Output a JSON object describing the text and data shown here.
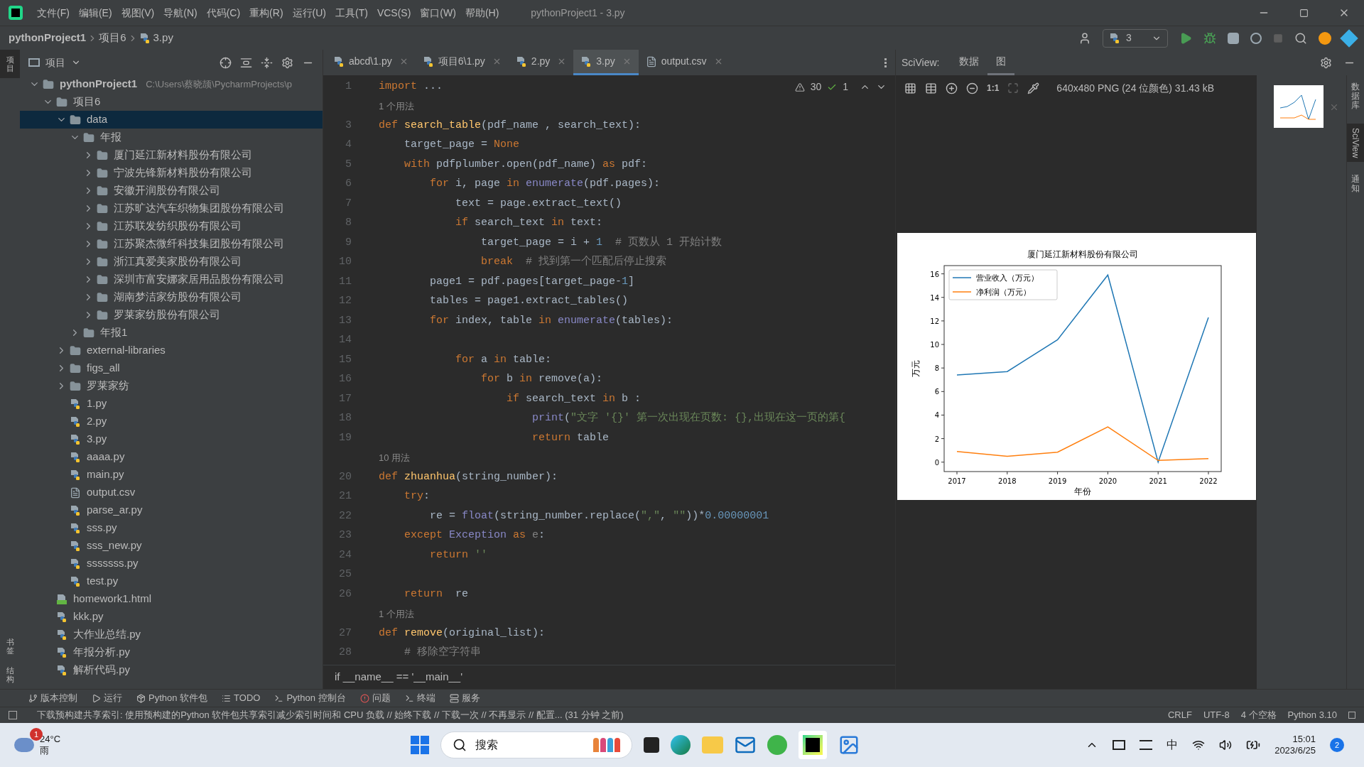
{
  "menu": [
    "文件(F)",
    "编辑(E)",
    "视图(V)",
    "导航(N)",
    "代码(C)",
    "重构(R)",
    "运行(U)",
    "工具(T)",
    "VCS(S)",
    "窗口(W)",
    "帮助(H)"
  ],
  "window": {
    "title": "pythonProject1 - 3.py"
  },
  "breadcrumb": [
    "pythonProject1",
    "项目6",
    "3.py"
  ],
  "run_config": "3",
  "left_strip": [
    {
      "label": "项目",
      "selected": true
    },
    {
      "label": "书签",
      "selected": false
    },
    {
      "label": "结构",
      "selected": false
    }
  ],
  "project_panel": {
    "title": "项目",
    "tree": [
      {
        "label": "pythonProject1",
        "path": "C:\\Users\\蔡晓颉\\PycharmProjects\\p",
        "kind": "folder",
        "expanded": true,
        "selected": false,
        "children": [
          {
            "label": "项目6",
            "kind": "folder",
            "expanded": true,
            "selected": false,
            "children": [
              {
                "label": "data",
                "kind": "folder",
                "expanded": true,
                "selected": true,
                "children": [
                  {
                    "label": "年报",
                    "kind": "folder",
                    "expanded": true,
                    "selected": false,
                    "children": [
                      {
                        "label": "厦门延江新材料股份有限公司",
                        "kind": "folder",
                        "expanded": false,
                        "selected": false
                      },
                      {
                        "label": "宁波先锋新材料股份有限公司",
                        "kind": "folder",
                        "expanded": false,
                        "selected": false
                      },
                      {
                        "label": "安徽开润股份有限公司",
                        "kind": "folder",
                        "expanded": false,
                        "selected": false
                      },
                      {
                        "label": "江苏旷达汽车织物集团股份有限公司",
                        "kind": "folder",
                        "expanded": false,
                        "selected": false
                      },
                      {
                        "label": "江苏联发纺织股份有限公司",
                        "kind": "folder",
                        "expanded": false,
                        "selected": false
                      },
                      {
                        "label": "江苏聚杰微纤科技集团股份有限公司",
                        "kind": "folder",
                        "expanded": false,
                        "selected": false
                      },
                      {
                        "label": "浙江真爱美家股份有限公司",
                        "kind": "folder",
                        "expanded": false,
                        "selected": false
                      },
                      {
                        "label": "深圳市富安娜家居用品股份有限公司",
                        "kind": "folder",
                        "expanded": false,
                        "selected": false
                      },
                      {
                        "label": "湖南梦洁家纺股份有限公司",
                        "kind": "folder",
                        "expanded": false,
                        "selected": false
                      },
                      {
                        "label": "罗莱家纺股份有限公司",
                        "kind": "folder",
                        "expanded": false,
                        "selected": false
                      }
                    ]
                  },
                  {
                    "label": "年报1",
                    "kind": "folder",
                    "expanded": false,
                    "selected": false
                  }
                ]
              },
              {
                "label": "external-libraries",
                "kind": "folder",
                "expanded": false,
                "selected": false
              },
              {
                "label": "figs_all",
                "kind": "folder",
                "expanded": false,
                "selected": false
              },
              {
                "label": "罗莱家纺",
                "kind": "folder",
                "expanded": false,
                "selected": false
              },
              {
                "label": "1.py",
                "kind": "py",
                "selected": false
              },
              {
                "label": "2.py",
                "kind": "py",
                "selected": false
              },
              {
                "label": "3.py",
                "kind": "py",
                "selected": false
              },
              {
                "label": "aaaa.py",
                "kind": "py",
                "selected": false
              },
              {
                "label": "main.py",
                "kind": "py",
                "selected": false
              },
              {
                "label": "output.csv",
                "kind": "csv",
                "selected": false
              },
              {
                "label": "parse_ar.py",
                "kind": "py",
                "selected": false
              },
              {
                "label": "sss.py",
                "kind": "py",
                "selected": false
              },
              {
                "label": "sss_new.py",
                "kind": "py",
                "selected": false
              },
              {
                "label": "sssssss.py",
                "kind": "py",
                "selected": false
              },
              {
                "label": "test.py",
                "kind": "py",
                "selected": false
              }
            ]
          },
          {
            "label": "homework1.html",
            "kind": "html",
            "selected": false
          },
          {
            "label": "kkk.py",
            "kind": "py",
            "selected": false
          },
          {
            "label": "大作业总结.py",
            "kind": "py",
            "selected": false
          },
          {
            "label": "年报分析.py",
            "kind": "py",
            "selected": false
          },
          {
            "label": "解析代码.py",
            "kind": "py",
            "selected": false
          }
        ]
      }
    ]
  },
  "editor_tabs": [
    {
      "label": "abcd\\1.py",
      "kind": "py",
      "selected": false
    },
    {
      "label": "项目6\\1.py",
      "kind": "py",
      "selected": false
    },
    {
      "label": "2.py",
      "kind": "py",
      "selected": false
    },
    {
      "label": "3.py",
      "kind": "py",
      "selected": true
    },
    {
      "label": "output.csv",
      "kind": "csv",
      "selected": false
    }
  ],
  "inspections": {
    "warnings": "30",
    "ok": "1"
  },
  "code": [
    {
      "kind": "code",
      "number": "1",
      "tokens": [
        {
          "kind": "kw",
          "s": "import"
        },
        {
          "kind": "plain",
          "s": " ..."
        }
      ]
    },
    {
      "kind": "hint",
      "text": "1 个用法"
    },
    {
      "kind": "code",
      "number": "3",
      "tokens": [
        {
          "kind": "kw",
          "s": "def "
        },
        {
          "kind": "fn",
          "s": "search_table"
        },
        {
          "kind": "plain",
          "s": "(pdf_name , search_text):"
        }
      ]
    },
    {
      "kind": "code",
      "number": "4",
      "tokens": [
        {
          "kind": "plain",
          "s": "    target_page = "
        },
        {
          "kind": "kw",
          "s": "None"
        }
      ]
    },
    {
      "kind": "code",
      "number": "5",
      "tokens": [
        {
          "kind": "kw",
          "s": "    with"
        },
        {
          "kind": "plain",
          "s": " pdfplumber.open(pdf_name) "
        },
        {
          "kind": "kw",
          "s": "as"
        },
        {
          "kind": "plain",
          "s": " pdf:"
        }
      ]
    },
    {
      "kind": "code",
      "number": "6",
      "tokens": [
        {
          "kind": "kw",
          "s": "        for"
        },
        {
          "kind": "plain",
          "s": " i, page "
        },
        {
          "kind": "kw",
          "s": "in"
        },
        {
          "kind": "builtin",
          "s": " enumerate"
        },
        {
          "kind": "plain",
          "s": "(pdf.pages):"
        }
      ]
    },
    {
      "kind": "code",
      "number": "7",
      "tokens": [
        {
          "kind": "plain",
          "s": "            text = page.extract_text()"
        }
      ]
    },
    {
      "kind": "code",
      "number": "8",
      "tokens": [
        {
          "kind": "kw",
          "s": "            if"
        },
        {
          "kind": "plain",
          "s": " search_text "
        },
        {
          "kind": "kw",
          "s": "in"
        },
        {
          "kind": "plain",
          "s": " text:"
        }
      ]
    },
    {
      "kind": "code",
      "number": "9",
      "tokens": [
        {
          "kind": "plain",
          "s": "                target_page = i + "
        },
        {
          "kind": "num",
          "s": "1"
        },
        {
          "kind": "cmt",
          "s": "  # 页数从 1 开始计数"
        }
      ]
    },
    {
      "kind": "code",
      "number": "10",
      "tokens": [
        {
          "kind": "kw",
          "s": "                break"
        },
        {
          "kind": "cmt",
          "s": "  # 找到第一个匹配后停止搜索"
        }
      ]
    },
    {
      "kind": "code",
      "number": "11",
      "tokens": [
        {
          "kind": "plain",
          "s": "        page1 = pdf.pages[target_page-"
        },
        {
          "kind": "num",
          "s": "1"
        },
        {
          "kind": "plain",
          "s": "]"
        }
      ]
    },
    {
      "kind": "code",
      "number": "12",
      "tokens": [
        {
          "kind": "plain",
          "s": "        tables = page1.extract_tables()"
        }
      ]
    },
    {
      "kind": "code",
      "number": "13",
      "tokens": [
        {
          "kind": "kw",
          "s": "        for"
        },
        {
          "kind": "plain",
          "s": " index, table "
        },
        {
          "kind": "kw",
          "s": "in"
        },
        {
          "kind": "builtin",
          "s": " enumerate"
        },
        {
          "kind": "plain",
          "s": "(tables):"
        }
      ]
    },
    {
      "kind": "code",
      "number": "14"
    },
    {
      "kind": "code",
      "number": "15",
      "tokens": [
        {
          "kind": "kw",
          "s": "            for"
        },
        {
          "kind": "plain",
          "s": " a "
        },
        {
          "kind": "kw",
          "s": "in"
        },
        {
          "kind": "plain",
          "s": " table:"
        }
      ]
    },
    {
      "kind": "code",
      "number": "16",
      "tokens": [
        {
          "kind": "kw",
          "s": "                for"
        },
        {
          "kind": "plain",
          "s": " b "
        },
        {
          "kind": "kw",
          "s": "in"
        },
        {
          "kind": "plain",
          "s": " remove(a):"
        }
      ]
    },
    {
      "kind": "code",
      "number": "17",
      "tokens": [
        {
          "kind": "kw",
          "s": "                    if"
        },
        {
          "kind": "plain",
          "s": " search_text "
        },
        {
          "kind": "kw",
          "s": "in"
        },
        {
          "kind": "plain",
          "s": " b :"
        }
      ]
    },
    {
      "kind": "code",
      "number": "18",
      "tokens": [
        {
          "kind": "builtin",
          "s": "                        print"
        },
        {
          "kind": "plain",
          "s": "("
        },
        {
          "kind": "str",
          "s": "\"文字 '{}' 第一次出现在页数: {},出现在这一页的第{"
        }
      ]
    },
    {
      "kind": "code",
      "number": "19",
      "tokens": [
        {
          "kind": "kw",
          "s": "                        return"
        },
        {
          "kind": "plain",
          "s": " table"
        }
      ]
    },
    {
      "kind": "hint",
      "text": "10 用法"
    },
    {
      "kind": "code",
      "number": "20",
      "tokens": [
        {
          "kind": "kw",
          "s": "def "
        },
        {
          "kind": "fn",
          "s": "zhuanhua"
        },
        {
          "kind": "plain",
          "s": "(string_number):"
        }
      ]
    },
    {
      "kind": "code",
      "number": "21",
      "tokens": [
        {
          "kind": "kw",
          "s": "    try"
        },
        {
          "kind": "plain",
          "s": ":"
        }
      ]
    },
    {
      "kind": "code",
      "number": "22",
      "tokens": [
        {
          "kind": "plain",
          "s": "        re = "
        },
        {
          "kind": "builtin",
          "s": "float"
        },
        {
          "kind": "plain",
          "s": "(string_number.replace("
        },
        {
          "kind": "str",
          "s": "\",\""
        },
        {
          "kind": "plain",
          "s": ", "
        },
        {
          "kind": "str",
          "s": "\"\""
        },
        {
          "kind": "plain",
          "s": "))*"
        },
        {
          "kind": "num",
          "s": "0.00000001"
        }
      ]
    },
    {
      "kind": "code",
      "number": "23",
      "tokens": [
        {
          "kind": "kw",
          "s": "    except"
        },
        {
          "kind": "builtin",
          "s": " Exception"
        },
        {
          "kind": "kw",
          "s": " as"
        },
        {
          "kind": "cmt",
          "s": " e"
        },
        {
          "kind": "plain",
          "s": ":"
        }
      ]
    },
    {
      "kind": "code",
      "number": "24",
      "tokens": [
        {
          "kind": "kw",
          "s": "        return"
        },
        {
          "kind": "str",
          "s": " ''"
        }
      ]
    },
    {
      "kind": "code",
      "number": "25"
    },
    {
      "kind": "code",
      "number": "26",
      "tokens": [
        {
          "kind": "kw",
          "s": "    return"
        },
        {
          "kind": "plain",
          "s": "  re"
        }
      ]
    },
    {
      "kind": "hint",
      "text": "1 个用法"
    },
    {
      "kind": "code",
      "number": "27",
      "tokens": [
        {
          "kind": "kw",
          "s": "def "
        },
        {
          "kind": "fn",
          "s": "remove"
        },
        {
          "kind": "plain",
          "s": "(original_list):"
        }
      ]
    },
    {
      "kind": "code",
      "number": "28",
      "tokens": [
        {
          "kind": "cmt",
          "s": "    # 移除空字符串"
        }
      ]
    }
  ],
  "editor_breadcrumb": "if __name__ == '__main__'",
  "sciview": {
    "label": "SciView:",
    "tabs": [
      {
        "label": "数据",
        "selected": false
      },
      {
        "label": "图",
        "selected": true
      }
    ],
    "actual_size": "1:1",
    "image_info": "640x480 PNG (24 位颜色) 31.43 kB",
    "chart_data": {
      "type": "line",
      "title": "厦门延江新材料股份有限公司",
      "xlabel": "年份",
      "ylabel": "万元",
      "categories": [
        "2017",
        "2018",
        "2019",
        "2020",
        "2021",
        "2022"
      ],
      "series": [
        {
          "name": "营业收入（万元）",
          "color": "#1f77b4",
          "values": [
            7.4,
            7.7,
            10.4,
            15.9,
            0.0,
            12.3
          ]
        },
        {
          "name": "净利润（万元）",
          "color": "#ff7f0e",
          "values": [
            0.9,
            0.5,
            0.85,
            3.0,
            0.15,
            0.3
          ]
        }
      ],
      "legend": "upper left",
      "ylim": [
        -0.8,
        16.7
      ],
      "yticks": [
        0,
        2,
        4,
        6,
        8,
        10,
        12,
        14,
        16
      ]
    }
  },
  "right_strip": [
    {
      "label": "数据库",
      "kind": "cjk",
      "selected": false
    },
    {
      "label": "SciView",
      "kind": "latin",
      "selected": true
    },
    {
      "label": "通知",
      "kind": "cjk",
      "selected": false
    }
  ],
  "tool_bar": [
    "版本控制",
    "运行",
    "Python 软件包",
    "TODO",
    "Python 控制台",
    "问题",
    "终端",
    "服务"
  ],
  "status": {
    "message": "下载预构建共享索引: 使用预构建的Python 软件包共享索引减少索引时间和 CPU 负载 // 始终下载 // 下载一次 // 不再显示 // 配置... (31 分钟 之前)",
    "items": [
      "CRLF",
      "UTF-8",
      "4 个空格",
      "Python 3.10"
    ]
  },
  "taskbar": {
    "weather": {
      "temp": "24°C",
      "condition": "雨",
      "badge": "1"
    },
    "search": "搜索",
    "ime": "中",
    "time": "15:01",
    "date": "2023/6/25",
    "notifications": "2"
  }
}
